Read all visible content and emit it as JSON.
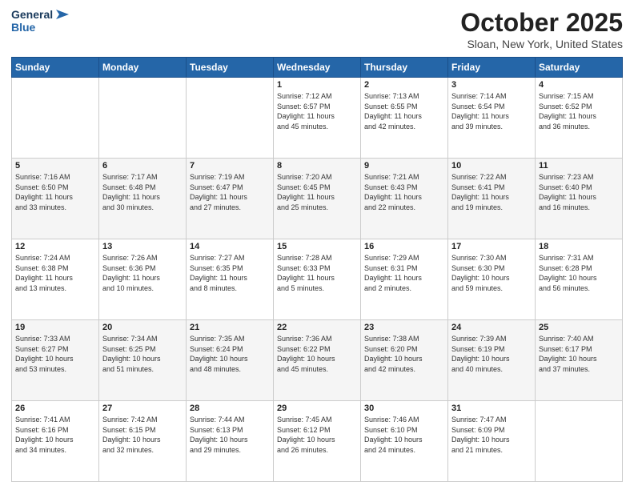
{
  "header": {
    "logo_line1": "General",
    "logo_line2": "Blue",
    "month": "October 2025",
    "location": "Sloan, New York, United States"
  },
  "weekdays": [
    "Sunday",
    "Monday",
    "Tuesday",
    "Wednesday",
    "Thursday",
    "Friday",
    "Saturday"
  ],
  "weeks": [
    [
      {
        "day": "",
        "info": ""
      },
      {
        "day": "",
        "info": ""
      },
      {
        "day": "",
        "info": ""
      },
      {
        "day": "1",
        "info": "Sunrise: 7:12 AM\nSunset: 6:57 PM\nDaylight: 11 hours\nand 45 minutes."
      },
      {
        "day": "2",
        "info": "Sunrise: 7:13 AM\nSunset: 6:55 PM\nDaylight: 11 hours\nand 42 minutes."
      },
      {
        "day": "3",
        "info": "Sunrise: 7:14 AM\nSunset: 6:54 PM\nDaylight: 11 hours\nand 39 minutes."
      },
      {
        "day": "4",
        "info": "Sunrise: 7:15 AM\nSunset: 6:52 PM\nDaylight: 11 hours\nand 36 minutes."
      }
    ],
    [
      {
        "day": "5",
        "info": "Sunrise: 7:16 AM\nSunset: 6:50 PM\nDaylight: 11 hours\nand 33 minutes."
      },
      {
        "day": "6",
        "info": "Sunrise: 7:17 AM\nSunset: 6:48 PM\nDaylight: 11 hours\nand 30 minutes."
      },
      {
        "day": "7",
        "info": "Sunrise: 7:19 AM\nSunset: 6:47 PM\nDaylight: 11 hours\nand 27 minutes."
      },
      {
        "day": "8",
        "info": "Sunrise: 7:20 AM\nSunset: 6:45 PM\nDaylight: 11 hours\nand 25 minutes."
      },
      {
        "day": "9",
        "info": "Sunrise: 7:21 AM\nSunset: 6:43 PM\nDaylight: 11 hours\nand 22 minutes."
      },
      {
        "day": "10",
        "info": "Sunrise: 7:22 AM\nSunset: 6:41 PM\nDaylight: 11 hours\nand 19 minutes."
      },
      {
        "day": "11",
        "info": "Sunrise: 7:23 AM\nSunset: 6:40 PM\nDaylight: 11 hours\nand 16 minutes."
      }
    ],
    [
      {
        "day": "12",
        "info": "Sunrise: 7:24 AM\nSunset: 6:38 PM\nDaylight: 11 hours\nand 13 minutes."
      },
      {
        "day": "13",
        "info": "Sunrise: 7:26 AM\nSunset: 6:36 PM\nDaylight: 11 hours\nand 10 minutes."
      },
      {
        "day": "14",
        "info": "Sunrise: 7:27 AM\nSunset: 6:35 PM\nDaylight: 11 hours\nand 8 minutes."
      },
      {
        "day": "15",
        "info": "Sunrise: 7:28 AM\nSunset: 6:33 PM\nDaylight: 11 hours\nand 5 minutes."
      },
      {
        "day": "16",
        "info": "Sunrise: 7:29 AM\nSunset: 6:31 PM\nDaylight: 11 hours\nand 2 minutes."
      },
      {
        "day": "17",
        "info": "Sunrise: 7:30 AM\nSunset: 6:30 PM\nDaylight: 10 hours\nand 59 minutes."
      },
      {
        "day": "18",
        "info": "Sunrise: 7:31 AM\nSunset: 6:28 PM\nDaylight: 10 hours\nand 56 minutes."
      }
    ],
    [
      {
        "day": "19",
        "info": "Sunrise: 7:33 AM\nSunset: 6:27 PM\nDaylight: 10 hours\nand 53 minutes."
      },
      {
        "day": "20",
        "info": "Sunrise: 7:34 AM\nSunset: 6:25 PM\nDaylight: 10 hours\nand 51 minutes."
      },
      {
        "day": "21",
        "info": "Sunrise: 7:35 AM\nSunset: 6:24 PM\nDaylight: 10 hours\nand 48 minutes."
      },
      {
        "day": "22",
        "info": "Sunrise: 7:36 AM\nSunset: 6:22 PM\nDaylight: 10 hours\nand 45 minutes."
      },
      {
        "day": "23",
        "info": "Sunrise: 7:38 AM\nSunset: 6:20 PM\nDaylight: 10 hours\nand 42 minutes."
      },
      {
        "day": "24",
        "info": "Sunrise: 7:39 AM\nSunset: 6:19 PM\nDaylight: 10 hours\nand 40 minutes."
      },
      {
        "day": "25",
        "info": "Sunrise: 7:40 AM\nSunset: 6:17 PM\nDaylight: 10 hours\nand 37 minutes."
      }
    ],
    [
      {
        "day": "26",
        "info": "Sunrise: 7:41 AM\nSunset: 6:16 PM\nDaylight: 10 hours\nand 34 minutes."
      },
      {
        "day": "27",
        "info": "Sunrise: 7:42 AM\nSunset: 6:15 PM\nDaylight: 10 hours\nand 32 minutes."
      },
      {
        "day": "28",
        "info": "Sunrise: 7:44 AM\nSunset: 6:13 PM\nDaylight: 10 hours\nand 29 minutes."
      },
      {
        "day": "29",
        "info": "Sunrise: 7:45 AM\nSunset: 6:12 PM\nDaylight: 10 hours\nand 26 minutes."
      },
      {
        "day": "30",
        "info": "Sunrise: 7:46 AM\nSunset: 6:10 PM\nDaylight: 10 hours\nand 24 minutes."
      },
      {
        "day": "31",
        "info": "Sunrise: 7:47 AM\nSunset: 6:09 PM\nDaylight: 10 hours\nand 21 minutes."
      },
      {
        "day": "",
        "info": ""
      }
    ]
  ]
}
